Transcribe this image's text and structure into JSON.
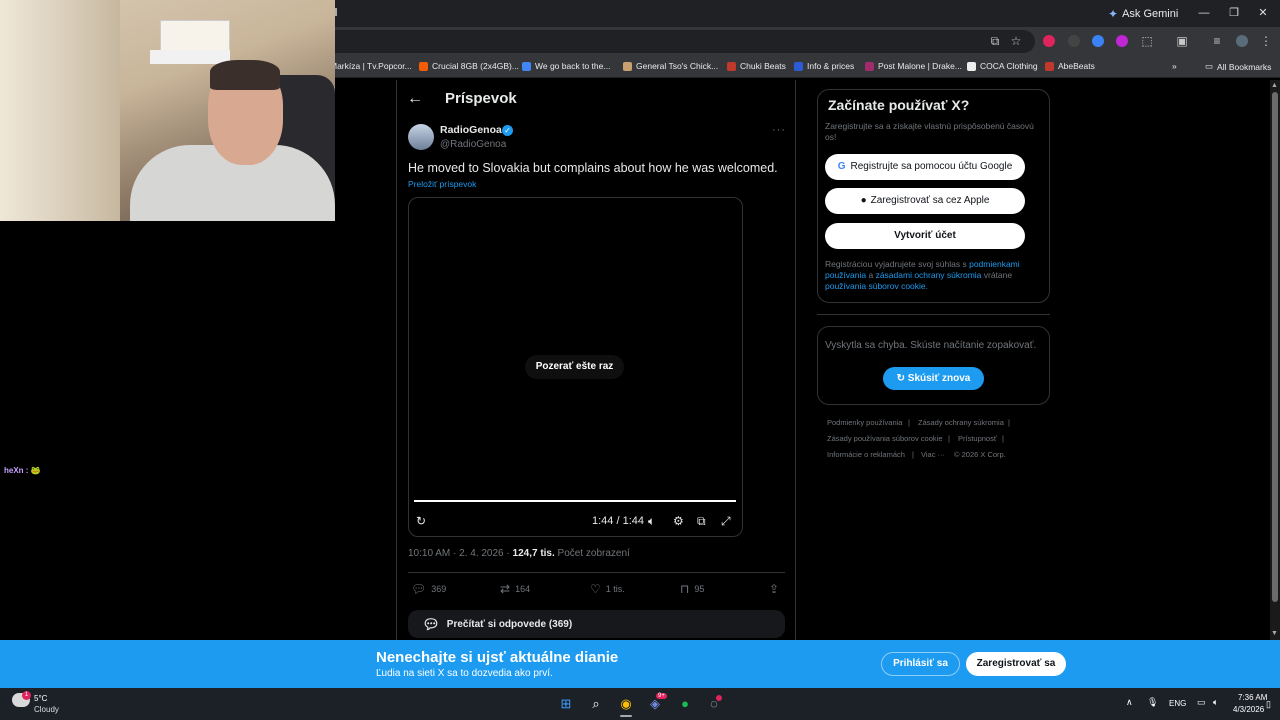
{
  "browser": {
    "ask_gemini": "Ask Gemini",
    "bookmarks": [
      {
        "label": "Markíza | Tv.Popcor...",
        "color": "#e8eaed"
      },
      {
        "label": "Crucial 8GB (2x4GB)...",
        "color": "#f25c05"
      },
      {
        "label": "We go back to the...",
        "color": "#4285f4"
      },
      {
        "label": "General Tso's Chick...",
        "color": "#c8a070"
      },
      {
        "label": "Chuki Beats",
        "color": "#c0392b"
      },
      {
        "label": "Info & prices",
        "color": "#2b5cd6"
      },
      {
        "label": "Post Malone | Drake...",
        "color": "#a02c6c"
      },
      {
        "label": "COCA Clothing",
        "color": "#eeeeee"
      },
      {
        "label": "AbeBeats",
        "color": "#c0392b"
      }
    ],
    "all_bookmarks": "All Bookmarks"
  },
  "chat": {
    "user": "heXn :",
    "emote": "🐸"
  },
  "post": {
    "page_title": "Príspevok",
    "author_name": "RadioGenoa",
    "author_handle": "@RadioGenoa",
    "text": "He moved to Slovakia but complains about how he was welcomed.",
    "translate": "Preložiť príspevok",
    "video": {
      "replay_label": "Pozerať ešte raz",
      "time": "1:44 / 1:44",
      "progress": 1.0
    },
    "timestamp": "10:10 AM · 2. 4. 2026 · ",
    "views_count": "124,7 tis.",
    "views_label": " Počet zobrazení",
    "stats": {
      "replies": "369",
      "reposts": "164",
      "likes": "1 tis.",
      "bookmarks": "95"
    },
    "read_replies": "Prečítať si odpovede (369)"
  },
  "sidebar": {
    "signup_title": "Začínate používať X?",
    "signup_sub": "Zaregistrujte sa a získajte vlastnú prispôsobenú časovú os!",
    "google_btn": "Registrujte sa pomocou účtu Google",
    "apple_btn": "Zaregistrovať sa cez Apple",
    "create_btn": "Vytvoriť účet",
    "legal_1": "Registráciou vyjadrujete svoj súhlas s ",
    "legal_link1": "podmienkami používania",
    "legal_2": " a ",
    "legal_link2": "zásadami ochrany súkromia",
    "legal_3": " vrátane ",
    "legal_link3": "používania súborov cookie",
    "legal_4": ".",
    "error_text": "Vyskytla sa chyba. Skúste načítanie zopakovať.",
    "retry_btn": "Skúsiť znova",
    "footer": {
      "terms": "Podmienky používania",
      "privacy": "Zásady ochrany súkromia",
      "cookies": "Zásady používania súborov cookie",
      "accessibility": "Prístupnosť",
      "ads": "Informácie o reklamách",
      "more": "Viac ···",
      "copyright": "© 2026 X Corp."
    }
  },
  "banner": {
    "title": "Nenechajte si ujsť aktuálne dianie",
    "subtitle": "Ľudia na sieti X sa to dozvedia ako prví.",
    "login": "Prihlásiť sa",
    "register": "Zaregistrovať sa"
  },
  "taskbar": {
    "weather_badge": "1",
    "temp": "5°C",
    "condition": "Cloudy",
    "discord_badge": "9+",
    "lang": "ENG",
    "time": "7:36 AM",
    "date": "4/3/2026"
  }
}
